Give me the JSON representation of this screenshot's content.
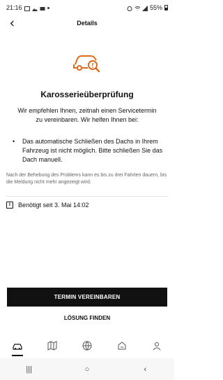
{
  "status_bar": {
    "time": "21:16",
    "battery": "55%"
  },
  "header": {
    "title": "Details",
    "back_icon": "chevron-left-icon"
  },
  "hero": {
    "icon": "car-search-icon",
    "accent_color": "#e06a1b"
  },
  "content": {
    "title": "Karosserieüberprüfung",
    "intro": "Wir empfehlen Ihnen, zeitnah einen Servicetermin zu vereinbaren. Wir helfen Ihnen bei:",
    "bullets": [
      "Das automatische Schließen des Dachs in Ihrem Fahrzeug ist nicht möglich. Bitte schließen Sie das Dach manuell."
    ],
    "note": "Nach der Behebung des Problems kann es bis zu drei Fahrten dauern, bis die Meldung nicht mehr angezeigt wird.",
    "info": "Benötigt seit 3. Mai 14:02"
  },
  "actions": {
    "primary": "TERMIN VEREINBAREN",
    "secondary": "LÖSUNG FINDEN"
  },
  "tabs": [
    {
      "icon": "car-icon",
      "active": true
    },
    {
      "icon": "map-icon",
      "active": false
    },
    {
      "icon": "globe-icon",
      "active": false
    },
    {
      "icon": "service-icon",
      "active": false
    },
    {
      "icon": "profile-icon",
      "active": false
    }
  ],
  "system_nav": {
    "recent": "|||",
    "home": "○",
    "back": "‹"
  }
}
